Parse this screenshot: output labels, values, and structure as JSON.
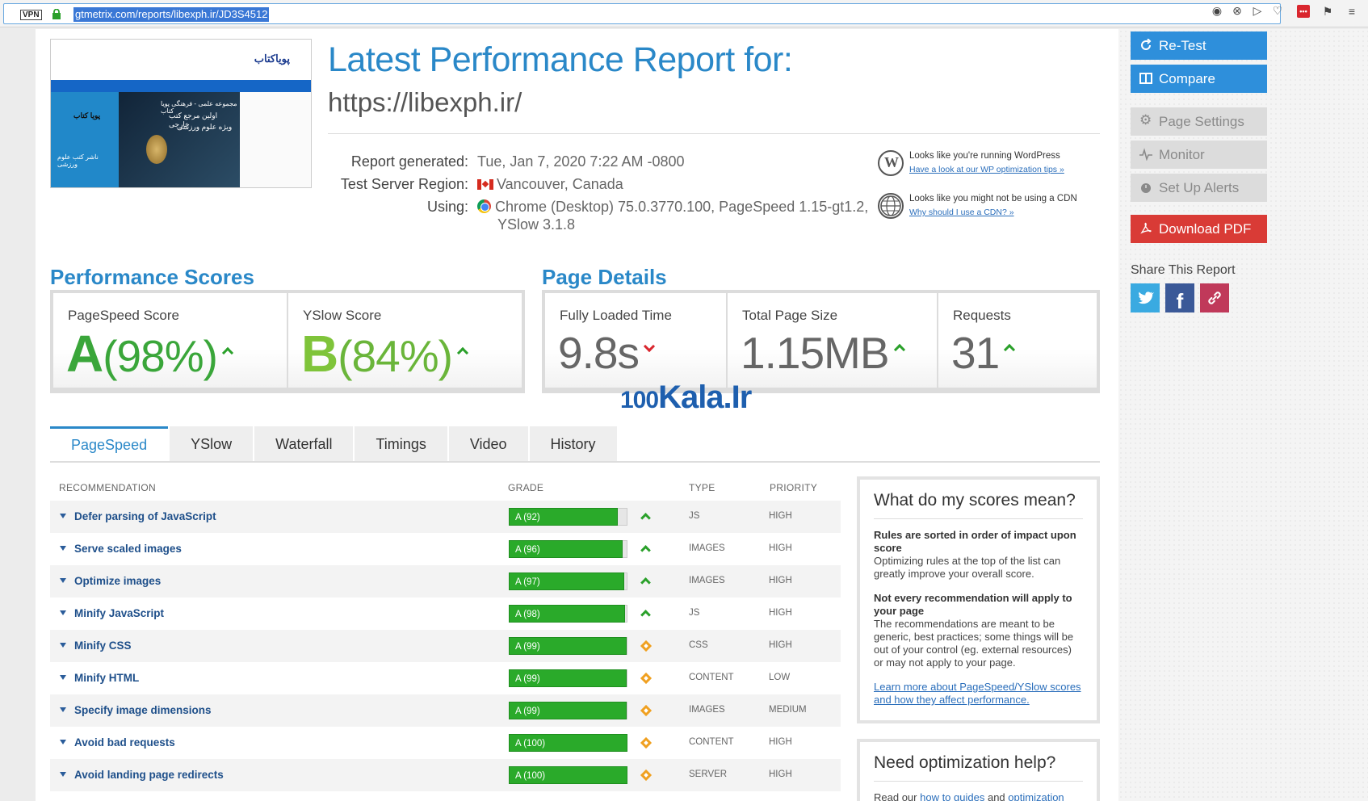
{
  "browser": {
    "vpn_label": "VPN",
    "url": "gtmetrix.com/reports/libexph.ir/JD3S4512"
  },
  "thumbnail": {
    "logo_text": "پویاکتاب",
    "left_label_1": "پویا کتاب",
    "left_label_2": "ناشر کتب علوم ورزشی",
    "hero_text_1": "مجموعه علمی - فرهنگی پویا کتاب",
    "hero_text_2": "اولین مرجع کتب خارجی",
    "hero_text_3": "ویژه علوم ورزشی"
  },
  "report": {
    "title": "Latest Performance Report for:",
    "url": "https://libexph.ir/",
    "generated_label": "Report generated:",
    "generated_value": "Tue, Jan 7, 2020 7:22 AM -0800",
    "region_label": "Test Server Region:",
    "region_value": "Vancouver, Canada",
    "using_label": "Using:",
    "using_value_1": "Chrome (Desktop) 75.0.3770.100, PageSpeed 1.15-gt1.2,",
    "using_value_2": "YSlow 3.1.8"
  },
  "tips": [
    {
      "text": "Looks like you're running WordPress",
      "link": "Have a look at our WP optimization tips »",
      "icon": "wordpress-icon"
    },
    {
      "text": "Looks like you might not be using a CDN",
      "link": "Why should I use a CDN? »",
      "icon": "globe-icon"
    }
  ],
  "performance": {
    "title": "Performance Scores",
    "pagespeed_label": "PageSpeed Score",
    "pagespeed_grade": "A",
    "pagespeed_pct": "(98%)",
    "yslow_label": "YSlow Score",
    "yslow_grade": "B",
    "yslow_pct": "(84%)",
    "grade_a_color": "#3aa63a",
    "grade_b_color": "#7fc43a"
  },
  "details": {
    "title": "Page Details",
    "load_label": "Fully Loaded Time",
    "load_value": "9.8s",
    "size_label": "Total Page Size",
    "size_value": "1.15MB",
    "req_label": "Requests",
    "req_value": "31"
  },
  "tabs": [
    "PageSpeed",
    "YSlow",
    "Waterfall",
    "Timings",
    "Video",
    "History"
  ],
  "table": {
    "col_recommendation": "RECOMMENDATION",
    "col_grade": "GRADE",
    "col_type": "TYPE",
    "col_priority": "PRIORITY",
    "rows": [
      {
        "name": "Defer parsing of JavaScript",
        "grade": "A (92)",
        "pct": 92,
        "trend": "up",
        "type": "JS",
        "priority": "HIGH"
      },
      {
        "name": "Serve scaled images",
        "grade": "A (96)",
        "pct": 96,
        "trend": "up",
        "type": "IMAGES",
        "priority": "HIGH"
      },
      {
        "name": "Optimize images",
        "grade": "A (97)",
        "pct": 97,
        "trend": "up",
        "type": "IMAGES",
        "priority": "HIGH"
      },
      {
        "name": "Minify JavaScript",
        "grade": "A (98)",
        "pct": 98,
        "trend": "up",
        "type": "JS",
        "priority": "HIGH"
      },
      {
        "name": "Minify CSS",
        "grade": "A (99)",
        "pct": 99,
        "trend": "same",
        "type": "CSS",
        "priority": "HIGH"
      },
      {
        "name": "Minify HTML",
        "grade": "A (99)",
        "pct": 99,
        "trend": "same",
        "type": "CONTENT",
        "priority": "LOW"
      },
      {
        "name": "Specify image dimensions",
        "grade": "A (99)",
        "pct": 99,
        "trend": "same",
        "type": "IMAGES",
        "priority": "MEDIUM"
      },
      {
        "name": "Avoid bad requests",
        "grade": "A (100)",
        "pct": 100,
        "trend": "same",
        "type": "CONTENT",
        "priority": "HIGH"
      },
      {
        "name": "Avoid landing page redirects",
        "grade": "A (100)",
        "pct": 100,
        "trend": "same",
        "type": "SERVER",
        "priority": "HIGH"
      }
    ]
  },
  "scores_box": {
    "title": "What do my scores mean?",
    "b1": "Rules are sorted in order of impact upon score",
    "p1": "Optimizing rules at the top of the list can greatly improve your overall score.",
    "b2": "Not every recommendation will apply to your page",
    "p2": "The recommendations are meant to be generic, best practices; some things will be out of your control (eg. external resources) or may not apply to your page.",
    "link": "Learn more about PageSpeed/YSlow scores and how they affect performance."
  },
  "help_box": {
    "title": "Need optimization help?",
    "text_1": "Read our",
    "link_1": "how to guides",
    "text_2": "and",
    "link_2": "optimization"
  },
  "sidebar": {
    "retest": "Re-Test",
    "compare": "Compare",
    "settings": "Page Settings",
    "monitor": "Monitor",
    "alerts": "Set Up Alerts",
    "pdf": "Download PDF",
    "share_title": "Share This Report"
  },
  "watermark": {
    "prefix": "100",
    "main": "Kala.Ir"
  }
}
